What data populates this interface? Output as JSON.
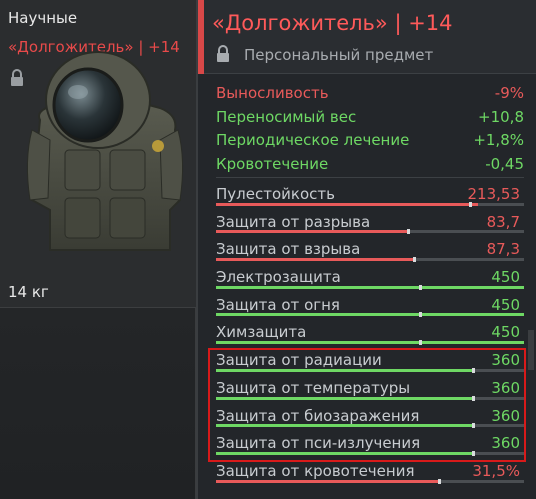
{
  "item_card": {
    "category": "Научные",
    "name": "«Долгожитель» | +14",
    "weight": "14 кг"
  },
  "tooltip": {
    "title": "«Долгожитель» | +14",
    "subtitle": "Персональный предмет",
    "effects": [
      {
        "label": "Выносливость",
        "value": "-9%",
        "kind": "neg"
      },
      {
        "label": "Переносимый вес",
        "value": "+10,8",
        "kind": "pos"
      },
      {
        "label": "Периодическое лечение",
        "value": "+1,8%",
        "kind": "pos"
      },
      {
        "label": "Кровотечение",
        "value": "-0,45",
        "kind": "pos"
      }
    ],
    "stats": [
      {
        "label": "Пулестойкость",
        "value": "213,53",
        "color": "red",
        "fill": 0.85,
        "notch": 0.82
      },
      {
        "label": "Защита от разрыва",
        "value": "83,7",
        "color": "red",
        "fill": 0.62,
        "notch": 0.62
      },
      {
        "label": "Защита от взрыва",
        "value": "87,3",
        "color": "red",
        "fill": 0.64,
        "notch": 0.64
      },
      {
        "label": "Электрозащита",
        "value": "450",
        "color": "green",
        "fill": 1.0,
        "notch": 0.66
      },
      {
        "label": "Защита от огня",
        "value": "450",
        "color": "green",
        "fill": 1.0,
        "notch": 0.66
      },
      {
        "label": "Химзащита",
        "value": "450",
        "color": "green",
        "fill": 1.0,
        "notch": 0.66
      },
      {
        "label": "Защита от радиации",
        "value": "360",
        "color": "green",
        "fill": 0.83,
        "notch": 0.83
      },
      {
        "label": "Защита от температуры",
        "value": "360",
        "color": "green",
        "fill": 0.83,
        "notch": 0.83
      },
      {
        "label": "Защита от биозаражения",
        "value": "360",
        "color": "green",
        "fill": 0.83,
        "notch": 0.83
      },
      {
        "label": "Защита от пси-излучения",
        "value": "360",
        "color": "green",
        "fill": 0.83,
        "notch": 0.83
      },
      {
        "label": "Защита от кровотечения",
        "value": "31,5%",
        "color": "red",
        "fill": 0.72,
        "notch": 0.72
      }
    ]
  },
  "colors": {
    "accent_red": "#d84848",
    "positive_green": "#6ed864",
    "negative_red": "#e85a5a",
    "highlight_box": "#d81a1a"
  }
}
